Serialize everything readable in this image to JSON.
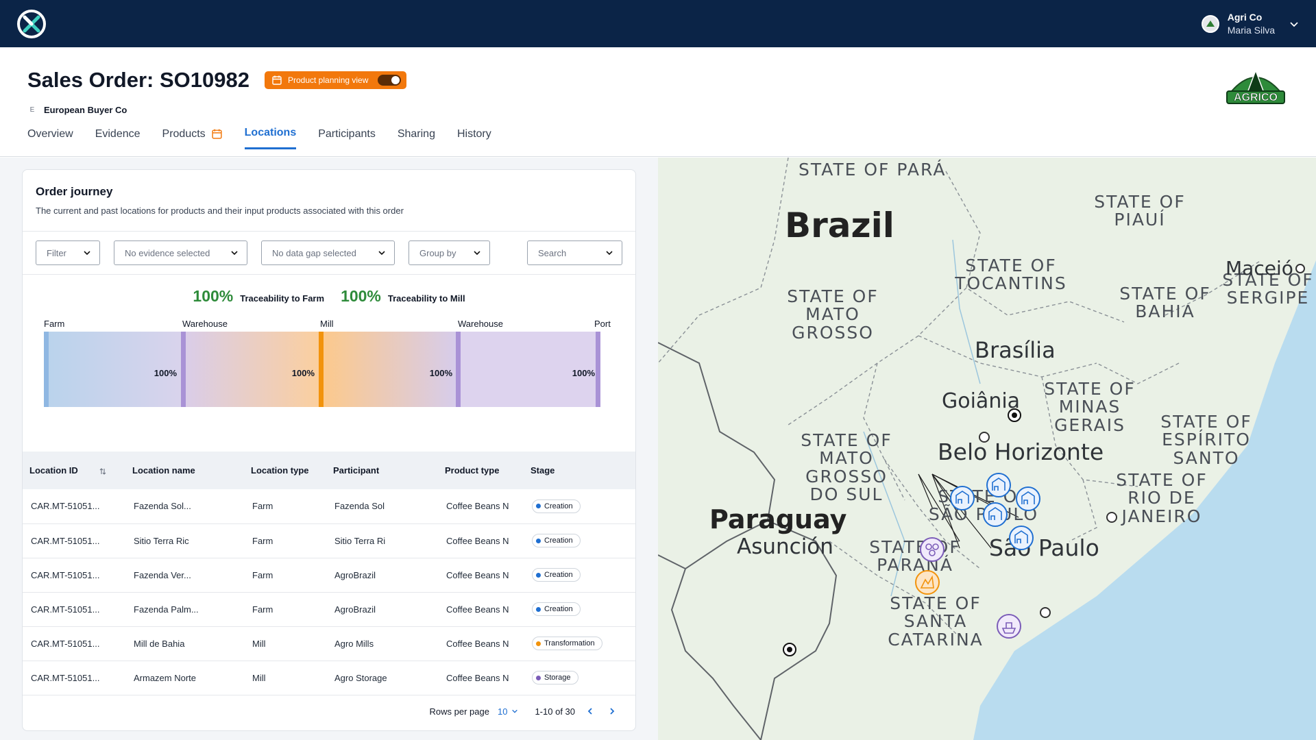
{
  "account": {
    "company": "Agri Co",
    "user": "Maria Silva"
  },
  "header": {
    "title": "Sales Order: SO10982",
    "planning_label": "Product planning view",
    "buyer_badge": "E",
    "buyer": "European Buyer Co",
    "logo_text": "AGRICO"
  },
  "tabs": [
    {
      "label": "Overview",
      "active": false
    },
    {
      "label": "Evidence",
      "active": false
    },
    {
      "label": "Products",
      "active": false
    },
    {
      "label": "Locations",
      "active": true
    },
    {
      "label": "Participants",
      "active": false
    },
    {
      "label": "Sharing",
      "active": false
    },
    {
      "label": "History",
      "active": false
    }
  ],
  "journey": {
    "title": "Order journey",
    "subtitle": "The current and past locations for products and their input products associated with this order",
    "filters": {
      "filter": "Filter",
      "evidence": "No evidence selected",
      "gap": "No data gap selected",
      "group": "Group by",
      "search": "Search"
    },
    "stats": [
      {
        "pct": "100%",
        "label": "Traceability to Farm"
      },
      {
        "pct": "100%",
        "label": "Traceability to Mill"
      }
    ],
    "stages": [
      "Farm",
      "Warehouse",
      "Mill",
      "Warehouse",
      "Port"
    ],
    "segments": [
      {
        "pct": "100%"
      },
      {
        "pct": "100%"
      },
      {
        "pct": "100%"
      },
      {
        "pct": "100%"
      }
    ]
  },
  "table": {
    "columns": [
      "Location ID",
      "Location name",
      "Location type",
      "Participant",
      "Product type",
      "Stage"
    ],
    "rows": [
      {
        "id": "CAR.MT-51051...",
        "name": "Fazenda Sol...",
        "type": "Farm",
        "participant": "Fazenda Sol",
        "product": "Coffee Beans N",
        "stage": "Creation",
        "color": "#1f6fd1"
      },
      {
        "id": "CAR.MT-51051...",
        "name": "Sitio Terra Ric",
        "type": "Farm",
        "participant": "Sitio Terra Ri",
        "product": "Coffee Beans N",
        "stage": "Creation",
        "color": "#1f6fd1"
      },
      {
        "id": "CAR.MT-51051...",
        "name": "Fazenda Ver...",
        "type": "Farm",
        "participant": "AgroBrazil",
        "product": "Coffee Beans N",
        "stage": "Creation",
        "color": "#1f6fd1"
      },
      {
        "id": "CAR.MT-51051...",
        "name": "Fazenda Palm...",
        "type": "Farm",
        "participant": "AgroBrazil",
        "product": "Coffee Beans N",
        "stage": "Creation",
        "color": "#1f6fd1"
      },
      {
        "id": "CAR.MT-51051...",
        "name": "Mill de Bahia",
        "type": "Mill",
        "participant": "Agro Mills",
        "product": "Coffee Beans N",
        "stage": "Transformation",
        "color": "#f2930c"
      },
      {
        "id": "CAR.MT-51051...",
        "name": "Armazem Norte",
        "type": "Mill",
        "participant": "Agro Storage",
        "product": "Coffee Beans N",
        "stage": "Storage",
        "color": "#7b5cb8"
      }
    ]
  },
  "pagination": {
    "rows_label": "Rows per page",
    "rows_value": "10",
    "range": "1-10 of 30"
  },
  "map": {
    "labels": {
      "para": "STATE OF PARÁ",
      "piaui": "STATE OF PIAUÍ",
      "tocantins": "STATE OF TOCANTINS",
      "mato_grosso": "STATE OF MATO GROSSO",
      "bahia": "STATE OF BAHIA",
      "sergipe": "STATE OF SERGIPE",
      "minas": "STATE OF MINAS GERAIS",
      "espirito": "STATE OF ESPÍRITO SANTO",
      "ms": "STATE OF MATO GROSSO DO SUL",
      "sao_paulo_state": "STATE OF SÃO PAULO",
      "rio": "STATE OF RIO DE JANEIRO",
      "parana": "STATE OF PARANÁ",
      "santa": "STATE OF SANTA CATARINA"
    },
    "cities": {
      "brazil": "Brazil",
      "maceio": "Maceió",
      "brasilia": "Brasília",
      "goiania": "Goiânia",
      "bh": "Belo Horizonte",
      "paraguay": "Paraguay",
      "asuncion": "Asunción",
      "sp": "São Paulo"
    }
  }
}
